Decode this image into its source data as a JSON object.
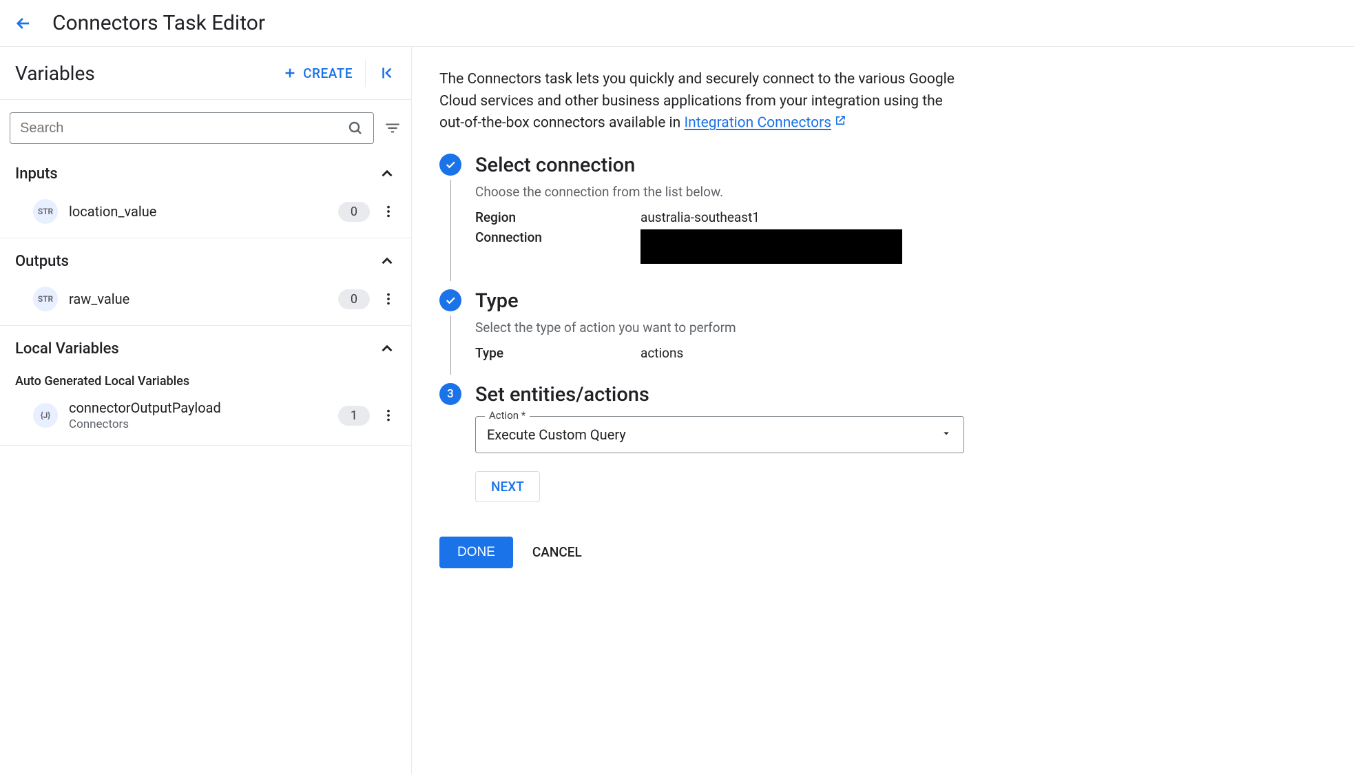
{
  "header": {
    "title": "Connectors Task Editor"
  },
  "sidebar": {
    "title": "Variables",
    "create_label": "CREATE",
    "search_placeholder": "Search",
    "sections": {
      "inputs": {
        "title": "Inputs",
        "items": [
          {
            "type": "STR",
            "name": "location_value",
            "count": "0"
          }
        ]
      },
      "outputs": {
        "title": "Outputs",
        "items": [
          {
            "type": "STR",
            "name": "raw_value",
            "count": "0"
          }
        ]
      },
      "local": {
        "title": "Local Variables",
        "subheader": "Auto Generated Local Variables",
        "items": [
          {
            "type": "{J}",
            "name": "connectorOutputPayload",
            "subtext": "Connectors",
            "count": "1"
          }
        ]
      }
    }
  },
  "content": {
    "intro_pre": "The Connectors task lets you quickly and securely connect to the various Google Cloud services and other business applications from your integration using the out-of-the-box connectors available in ",
    "intro_link": "Integration Connectors",
    "steps": {
      "s1": {
        "title": "Select connection",
        "subtitle": "Choose the connection from the list below.",
        "region_label": "Region",
        "region_value": "australia-southeast1",
        "connection_label": "Connection"
      },
      "s2": {
        "title": "Type",
        "subtitle": "Select the type of action you want to perform",
        "type_label": "Type",
        "type_value": "actions"
      },
      "s3": {
        "number": "3",
        "title": "Set entities/actions",
        "action_label": "Action *",
        "action_value": "Execute Custom Query"
      }
    },
    "next_label": "NEXT",
    "done_label": "DONE",
    "cancel_label": "CANCEL"
  }
}
